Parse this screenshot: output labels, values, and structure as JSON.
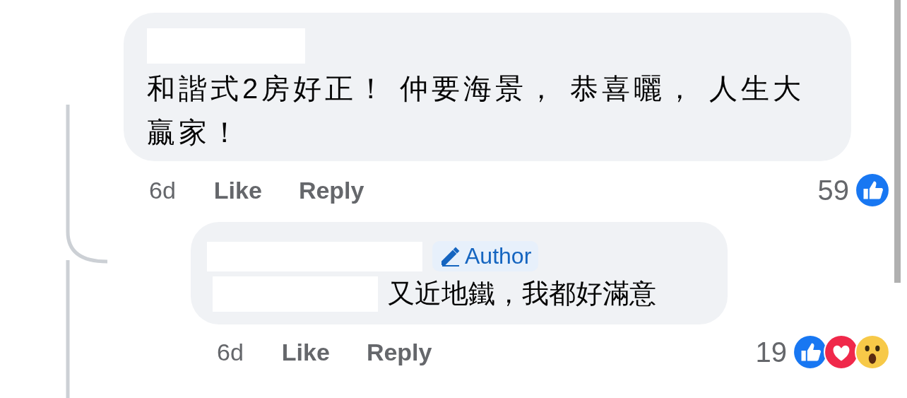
{
  "comments": [
    {
      "author_redacted": true,
      "text": "和諧式2房好正！ 仲要海景， 恭喜曬， 人生大贏家！",
      "time": "6d",
      "actions": [
        "Like",
        "Reply"
      ],
      "reaction_count": "59",
      "reactions": [
        {
          "kind": "like"
        }
      ]
    },
    {
      "author_redacted": true,
      "author_badge": "Author",
      "text": "又近地鐵，我都好滿意",
      "time": "6d",
      "actions": [
        "Like",
        "Reply"
      ],
      "reaction_count": "19",
      "reactions": [
        {
          "kind": "like"
        },
        {
          "kind": "love"
        },
        {
          "kind": "wow"
        }
      ]
    }
  ]
}
